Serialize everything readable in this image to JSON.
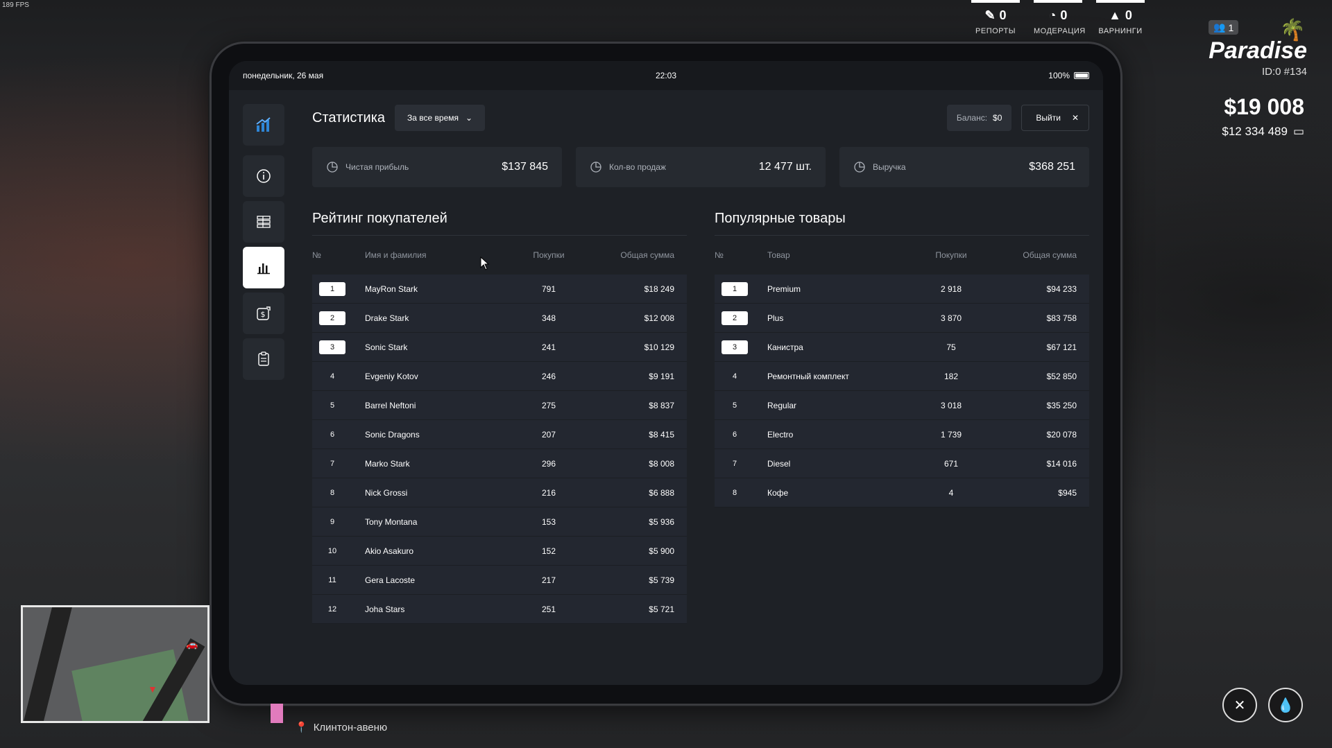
{
  "hud": {
    "fps": "189 FPS",
    "stats": [
      {
        "value": "0",
        "label": "РЕПОРТЫ",
        "icon": "report-icon"
      },
      {
        "value": "0",
        "label": "МОДЕРАЦИЯ",
        "icon": "moderation-icon"
      },
      {
        "value": "0",
        "label": "ВАРНИНГИ",
        "icon": "warning-icon"
      }
    ],
    "online": "1",
    "brand": "Paradise",
    "player_id": "ID:0 #134",
    "cash": "$19 008",
    "bank": "$12 334 489",
    "location": "Клинтон-авеню"
  },
  "tablet": {
    "date": "понедельник, 26 мая",
    "time": "22:03",
    "battery": "100%",
    "battery_level": 1.0
  },
  "sidebar": {
    "items": [
      {
        "name": "stats-logo",
        "icon": "growth-chart-icon"
      },
      {
        "name": "info",
        "icon": "info-icon"
      },
      {
        "name": "list",
        "icon": "list-icon"
      },
      {
        "name": "statistics",
        "icon": "bar-chart-icon",
        "active": true
      },
      {
        "name": "finance",
        "icon": "money-transfer-icon"
      },
      {
        "name": "clipboard",
        "icon": "clipboard-icon"
      }
    ]
  },
  "header": {
    "title": "Статистика",
    "period": "За все время",
    "balance_label": "Баланс:",
    "balance_value": "$0",
    "exit_label": "Выйти"
  },
  "kpis": [
    {
      "label": "Чистая прибыль",
      "value": "$137 845"
    },
    {
      "label": "Кол-во продаж",
      "value": "12 477 шт."
    },
    {
      "label": "Выручка",
      "value": "$368 251"
    }
  ],
  "buyers": {
    "title": "Рейтинг покупателей",
    "columns": [
      "№",
      "Имя и фамилия",
      "Покупки",
      "Общая сумма"
    ],
    "rows": [
      {
        "n": "1",
        "name": "MayRon Stark",
        "buys": "791",
        "sum": "$18 249"
      },
      {
        "n": "2",
        "name": "Drake Stark",
        "buys": "348",
        "sum": "$12 008"
      },
      {
        "n": "3",
        "name": "Sonic Stark",
        "buys": "241",
        "sum": "$10 129"
      },
      {
        "n": "4",
        "name": "Evgeniy Kotov",
        "buys": "246",
        "sum": "$9 191"
      },
      {
        "n": "5",
        "name": "Barrel Neftoni",
        "buys": "275",
        "sum": "$8 837"
      },
      {
        "n": "6",
        "name": "Sonic Dragons",
        "buys": "207",
        "sum": "$8 415"
      },
      {
        "n": "7",
        "name": "Marko Stark",
        "buys": "296",
        "sum": "$8 008"
      },
      {
        "n": "8",
        "name": "Nick Grossi",
        "buys": "216",
        "sum": "$6 888"
      },
      {
        "n": "9",
        "name": "Tony Montana",
        "buys": "153",
        "sum": "$5 936"
      },
      {
        "n": "10",
        "name": "Akio Asakuro",
        "buys": "152",
        "sum": "$5 900"
      },
      {
        "n": "11",
        "name": "Gera Lacoste",
        "buys": "217",
        "sum": "$5 739"
      },
      {
        "n": "12",
        "name": "Joha Stars",
        "buys": "251",
        "sum": "$5 721"
      }
    ]
  },
  "products": {
    "title": "Популярные товары",
    "columns": [
      "№",
      "Товар",
      "Покупки",
      "Общая сумма"
    ],
    "rows": [
      {
        "n": "1",
        "name": "Premium",
        "buys": "2 918",
        "sum": "$94 233"
      },
      {
        "n": "2",
        "name": "Plus",
        "buys": "3 870",
        "sum": "$83 758"
      },
      {
        "n": "3",
        "name": "Канистра",
        "buys": "75",
        "sum": "$67 121"
      },
      {
        "n": "4",
        "name": "Ремонтный комплект",
        "buys": "182",
        "sum": "$52 850"
      },
      {
        "n": "5",
        "name": "Regular",
        "buys": "3 018",
        "sum": "$35 250"
      },
      {
        "n": "6",
        "name": "Electro",
        "buys": "1 739",
        "sum": "$20 078"
      },
      {
        "n": "7",
        "name": "Diesel",
        "buys": "671",
        "sum": "$14 016"
      },
      {
        "n": "8",
        "name": "Кофе",
        "buys": "4",
        "sum": "$945"
      }
    ]
  },
  "colors": {
    "accent": "#2f86d6",
    "panel": "#1e2126",
    "card": "#262a30"
  }
}
